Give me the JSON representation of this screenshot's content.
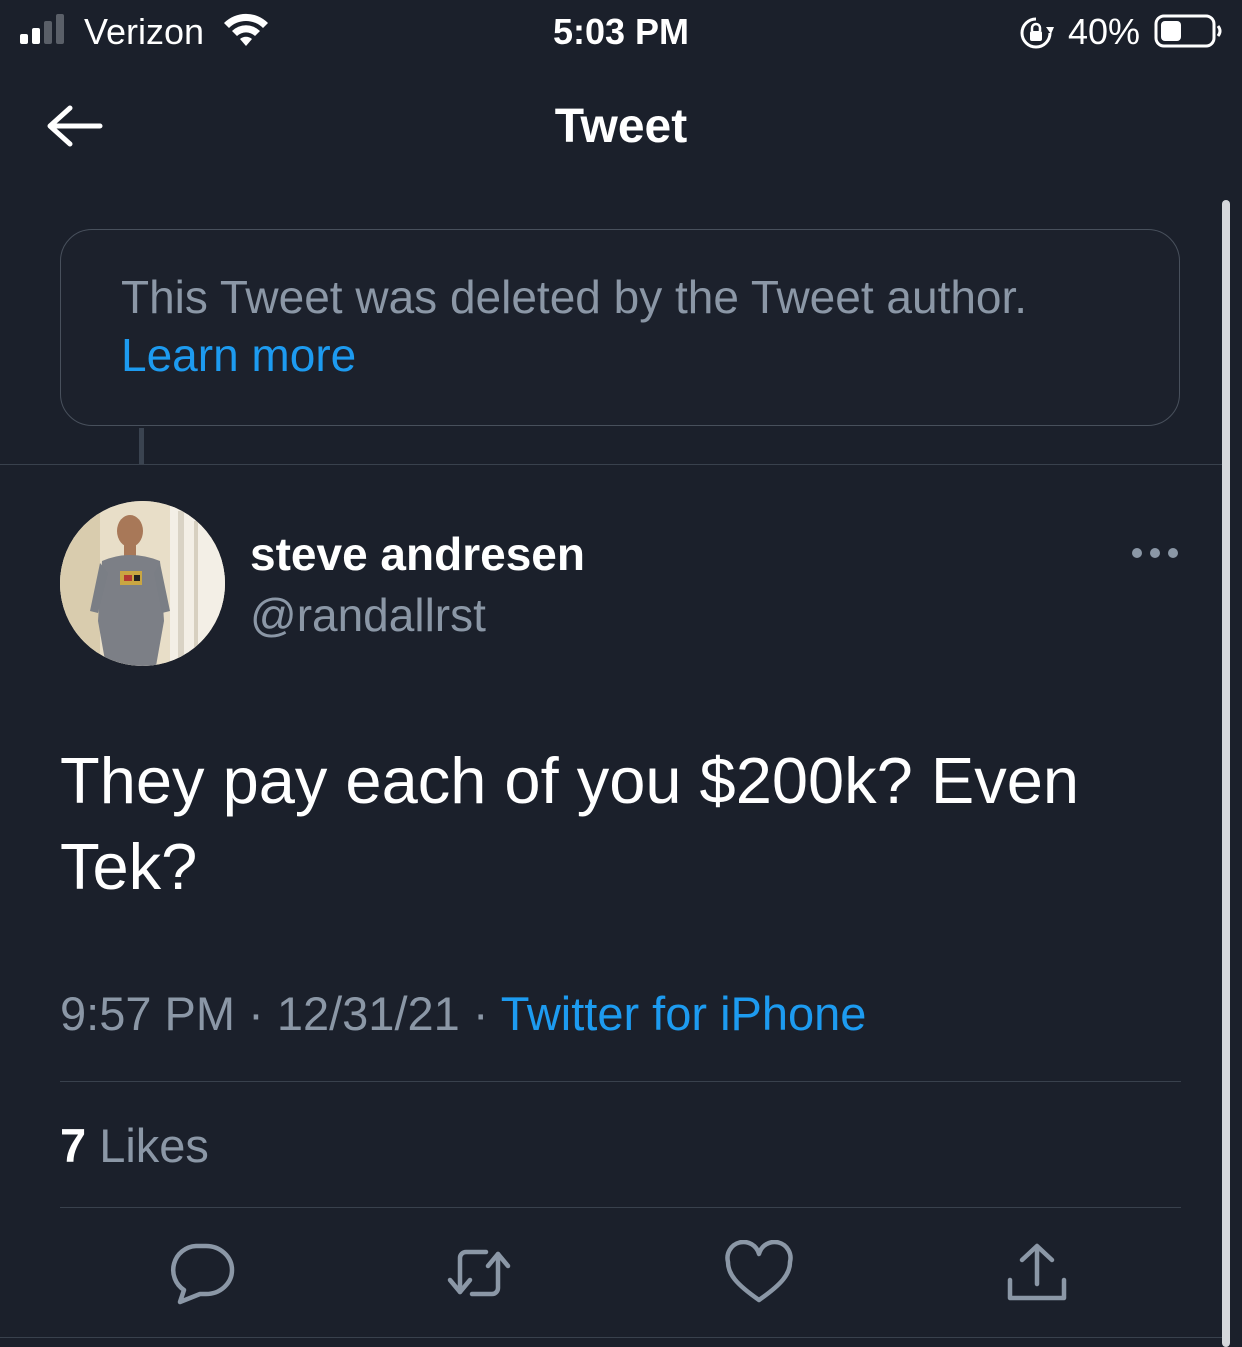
{
  "status_bar": {
    "carrier": "Verizon",
    "time": "5:03 PM",
    "battery_percent": "40%",
    "icons": [
      "signal-icon",
      "wifi-icon",
      "orientation-lock-icon",
      "battery-icon"
    ]
  },
  "header": {
    "title": "Tweet",
    "back_icon": "arrow-left-icon"
  },
  "deleted_notice": {
    "text": "This Tweet was deleted by the Tweet author.",
    "link": "Learn more"
  },
  "tweet": {
    "author": {
      "display_name": "steve andresen",
      "handle": "@randallrst"
    },
    "text": "They pay each of you $200k? Even Tek?",
    "time": "9:57 PM",
    "date": "12/31/21",
    "separator": "·",
    "source": "Twitter for iPhone",
    "likes_count": "7",
    "likes_label": "Likes"
  },
  "actions": {
    "icons": [
      "reply-icon",
      "retweet-icon",
      "like-icon",
      "share-icon"
    ]
  },
  "colors": {
    "background": "#1b202b",
    "accent": "#1d9bf0",
    "secondary_text": "#8b97a6",
    "divider": "#39414d"
  }
}
